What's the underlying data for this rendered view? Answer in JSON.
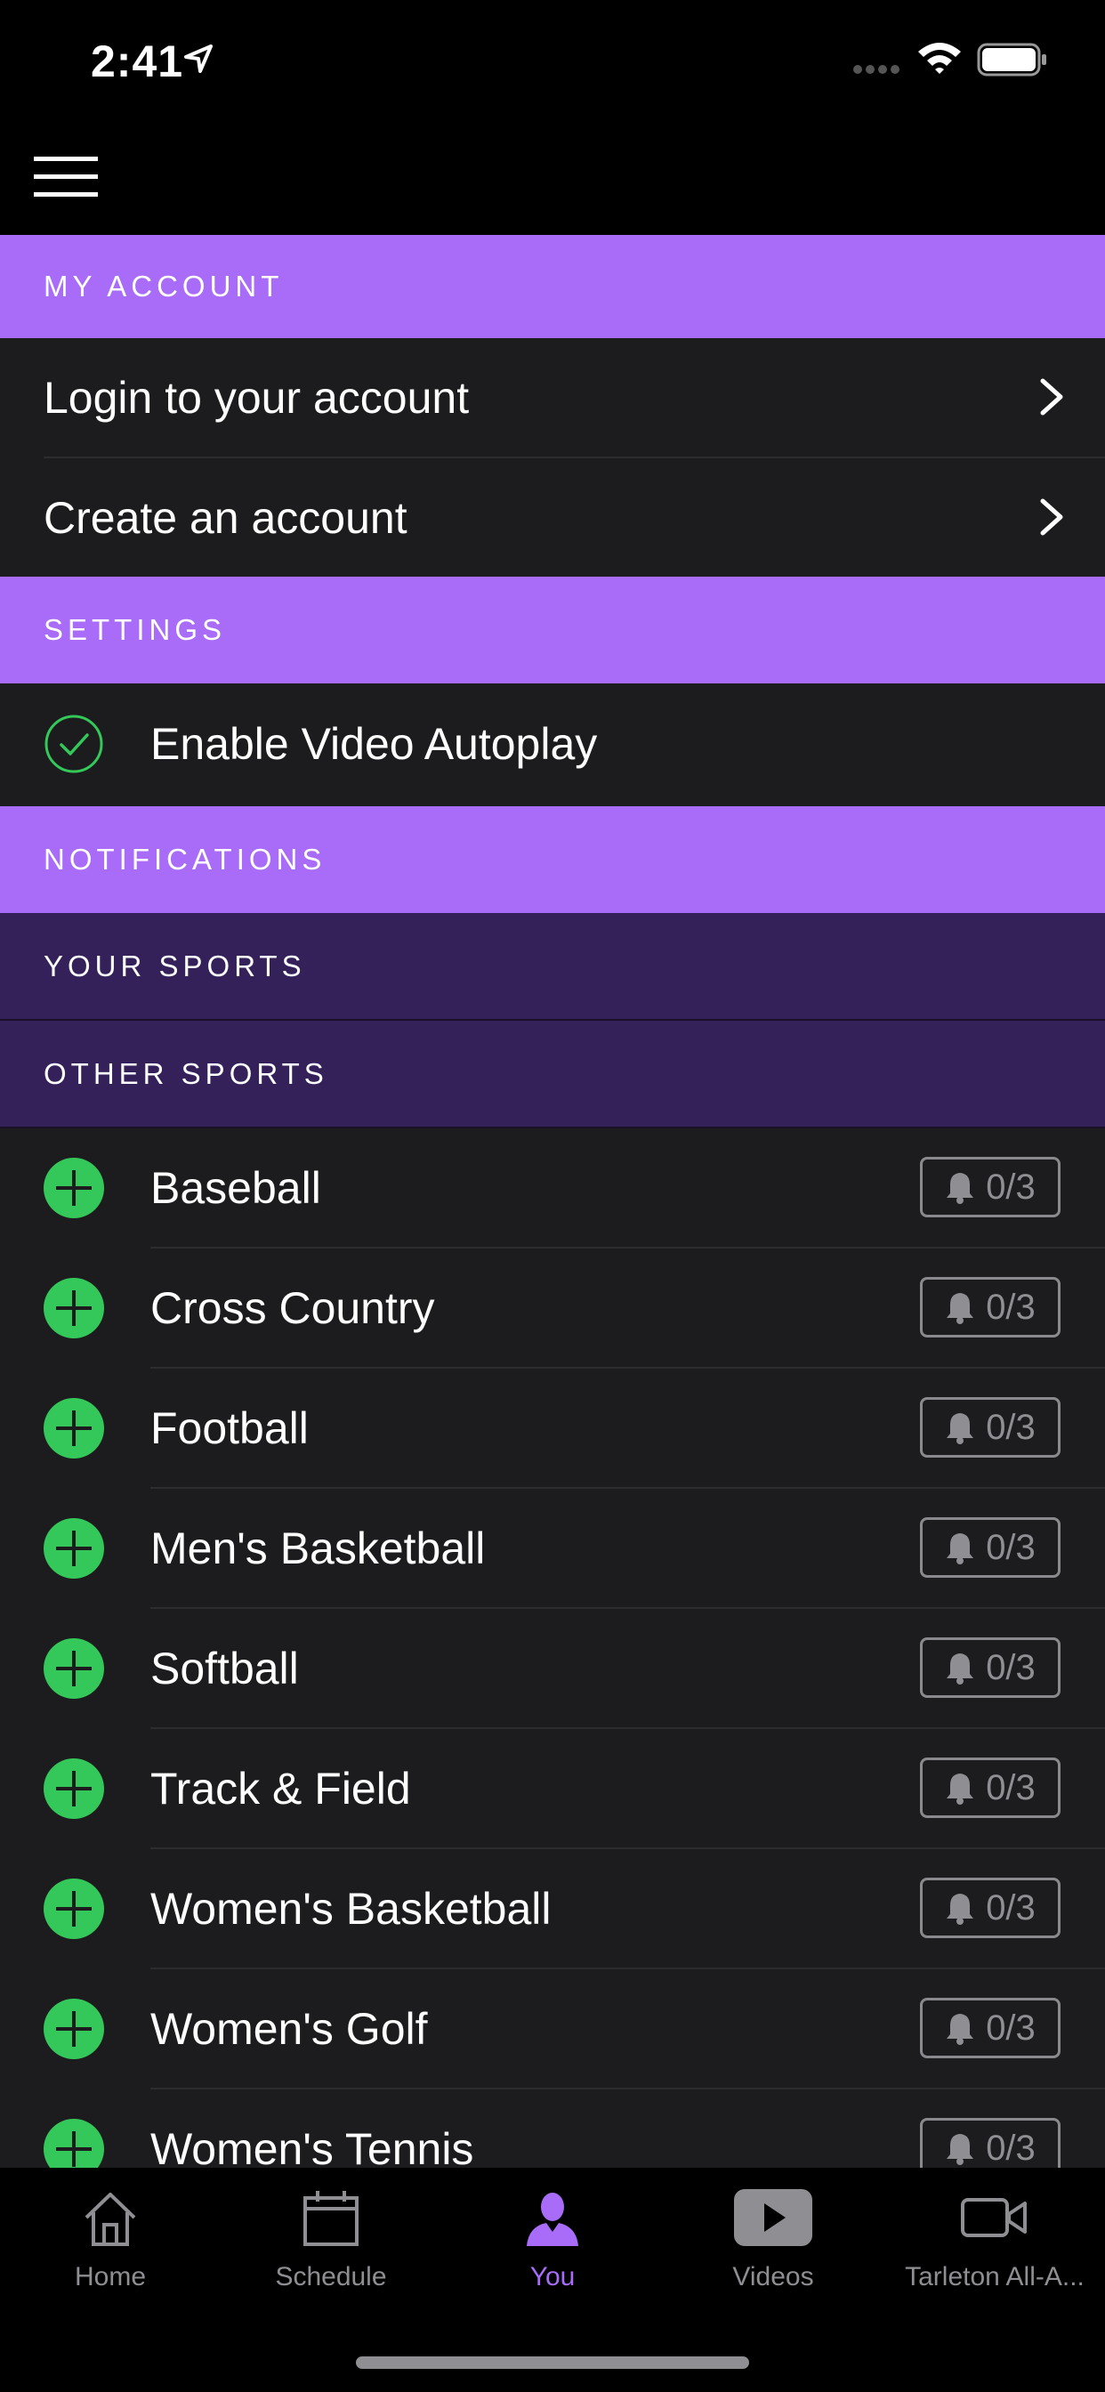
{
  "status_bar": {
    "time": "2:41"
  },
  "account": {
    "header": "MY ACCOUNT",
    "rows": [
      {
        "label": "Login to your account"
      },
      {
        "label": "Create an account"
      }
    ]
  },
  "settings": {
    "header": "SETTINGS",
    "autoplay_label": "Enable Video Autoplay"
  },
  "notifications": {
    "header": "NOTIFICATIONS",
    "your_sports_header": "YOUR SPORTS",
    "other_sports_header": "OTHER SPORTS",
    "sports": [
      {
        "name": "Baseball",
        "count": "0/3"
      },
      {
        "name": "Cross Country",
        "count": "0/3"
      },
      {
        "name": "Football",
        "count": "0/3"
      },
      {
        "name": "Men's Basketball",
        "count": "0/3"
      },
      {
        "name": "Softball",
        "count": "0/3"
      },
      {
        "name": "Track & Field",
        "count": "0/3"
      },
      {
        "name": "Women's Basketball",
        "count": "0/3"
      },
      {
        "name": "Women's Golf",
        "count": "0/3"
      },
      {
        "name": "Women's Tennis",
        "count": "0/3"
      }
    ]
  },
  "tabs": [
    {
      "label": "Home",
      "icon": "home-icon"
    },
    {
      "label": "Schedule",
      "icon": "calendar-icon"
    },
    {
      "label": "You",
      "icon": "person-icon",
      "active": true
    },
    {
      "label": "Videos",
      "icon": "play-icon"
    },
    {
      "label": "Tarleton All-A...",
      "icon": "video-camera-icon"
    }
  ],
  "colors": {
    "accent": "#a86cf8",
    "sub_header": "#35215a",
    "row_background": "#1c1c1e",
    "green": "#34c759"
  }
}
